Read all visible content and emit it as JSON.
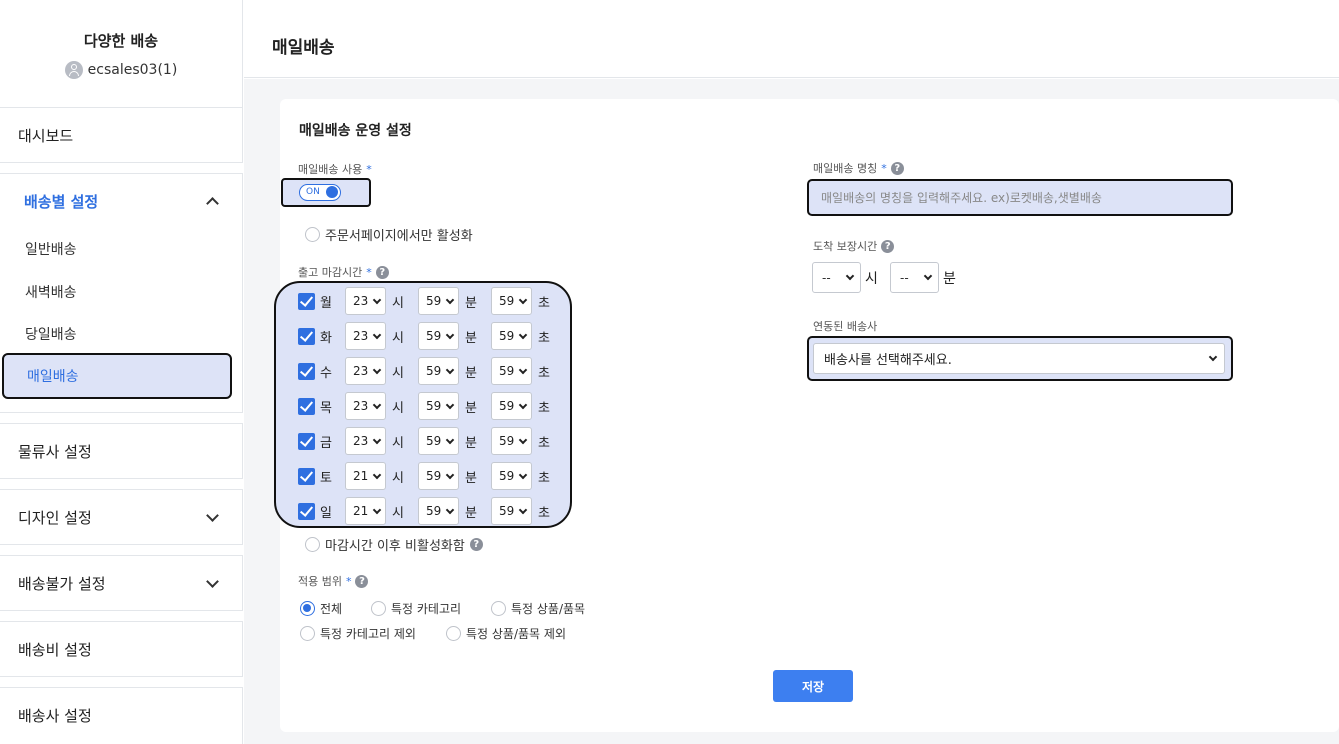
{
  "brand": {
    "title": "다양한 배송",
    "user": "ecsales03(1)"
  },
  "nav": {
    "dashboard": "대시보드",
    "delivery_settings": "배송별 설정",
    "sub_items": [
      "일반배송",
      "새벽배송",
      "당일배송",
      "매일배송"
    ],
    "logistics": "물류사 설정",
    "design": "디자인 설정",
    "undeliverable": "배송불가 설정",
    "shipping_fee": "배송비 설정",
    "carrier_settings": "배송사 설정"
  },
  "header": {
    "title": "매일배송"
  },
  "form": {
    "section_title": "매일배송 운영 설정",
    "use_label": "매일배송 사용",
    "required_mark": "*",
    "toggle_text": "ON",
    "checkout_only": "주문서페이지에서만 활성화",
    "cutoff_label": "출고 마감시간",
    "unit_hour": "시",
    "unit_min": "분",
    "unit_sec": "초",
    "schedule": [
      {
        "day": "월",
        "hour": "23",
        "min": "59",
        "sec": "59"
      },
      {
        "day": "화",
        "hour": "23",
        "min": "59",
        "sec": "59"
      },
      {
        "day": "수",
        "hour": "23",
        "min": "59",
        "sec": "59"
      },
      {
        "day": "목",
        "hour": "23",
        "min": "59",
        "sec": "59"
      },
      {
        "day": "금",
        "hour": "23",
        "min": "59",
        "sec": "59"
      },
      {
        "day": "토",
        "hour": "21",
        "min": "59",
        "sec": "59"
      },
      {
        "day": "일",
        "hour": "21",
        "min": "59",
        "sec": "59"
      }
    ],
    "disable_after_cutoff": "마감시간 이후 비활성화함",
    "scope_label": "적용 범위",
    "scope_options": [
      "전체",
      "특정 카테고리",
      "특정 상품/품목",
      "특정 카테고리 제외",
      "특정 상품/품목 제외"
    ],
    "name_label": "매일배송 명칭",
    "name_placeholder": "매일배송의 명칭을 입력해주세요. ex)로켓배송,샛별배송",
    "guarantee_label": "도착 보장시간",
    "guarantee_hour": "--",
    "guarantee_min": "--",
    "carrier_label": "연동된 배송사",
    "carrier_placeholder": "배송사를 선택해주세요.",
    "save": "저장",
    "help_glyph": "?"
  }
}
